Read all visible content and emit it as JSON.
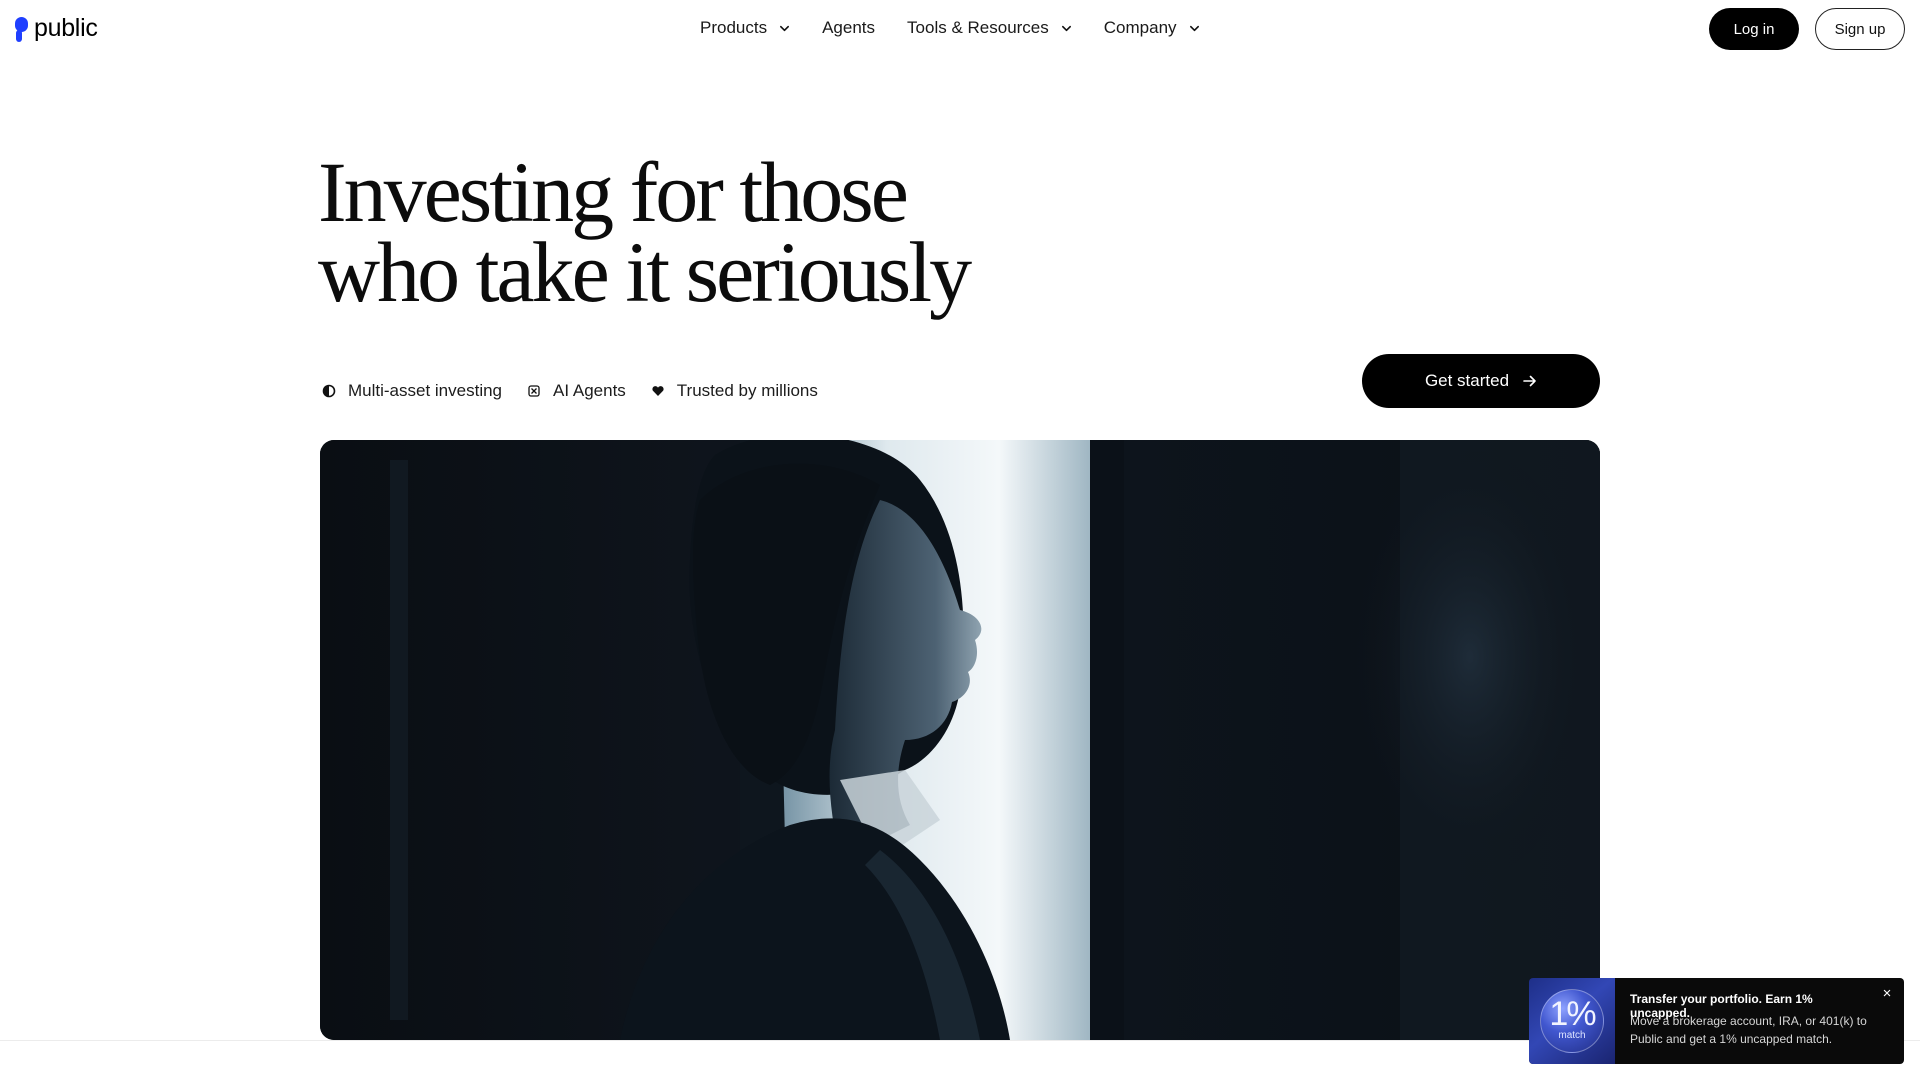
{
  "nav": {
    "brand": "public",
    "menu": [
      {
        "label": "Products",
        "has_dropdown": true
      },
      {
        "label": "Agents",
        "has_dropdown": false
      },
      {
        "label": "Tools & Resources",
        "has_dropdown": true
      },
      {
        "label": "Company",
        "has_dropdown": true
      }
    ],
    "login_label": "Log in",
    "signup_label": "Sign up"
  },
  "hero": {
    "title_line1": "Investing for those",
    "title_line2": "who take it seriously",
    "features": [
      {
        "label": "Multi-asset investing",
        "icon": "half-circle-icon"
      },
      {
        "label": "AI Agents",
        "icon": "agent-icon"
      },
      {
        "label": "Trusted by millions",
        "icon": "heart-icon"
      }
    ],
    "cta_label": "Get started",
    "media": "photo of a woman in profile in a dark room lit by a bright window"
  },
  "promo": {
    "badge_value": "1%",
    "badge_caption": "match",
    "title": "Transfer your portfolio. Earn 1% uncapped.",
    "body": "Move a brokerage account, IRA, or 401(k) to Public and get a 1% uncapped match.",
    "close_icon": "close-icon"
  },
  "colors": {
    "brand_blue": "#1f3fff",
    "primary_button": "#000000",
    "toast_background": "#0a0a0a"
  }
}
